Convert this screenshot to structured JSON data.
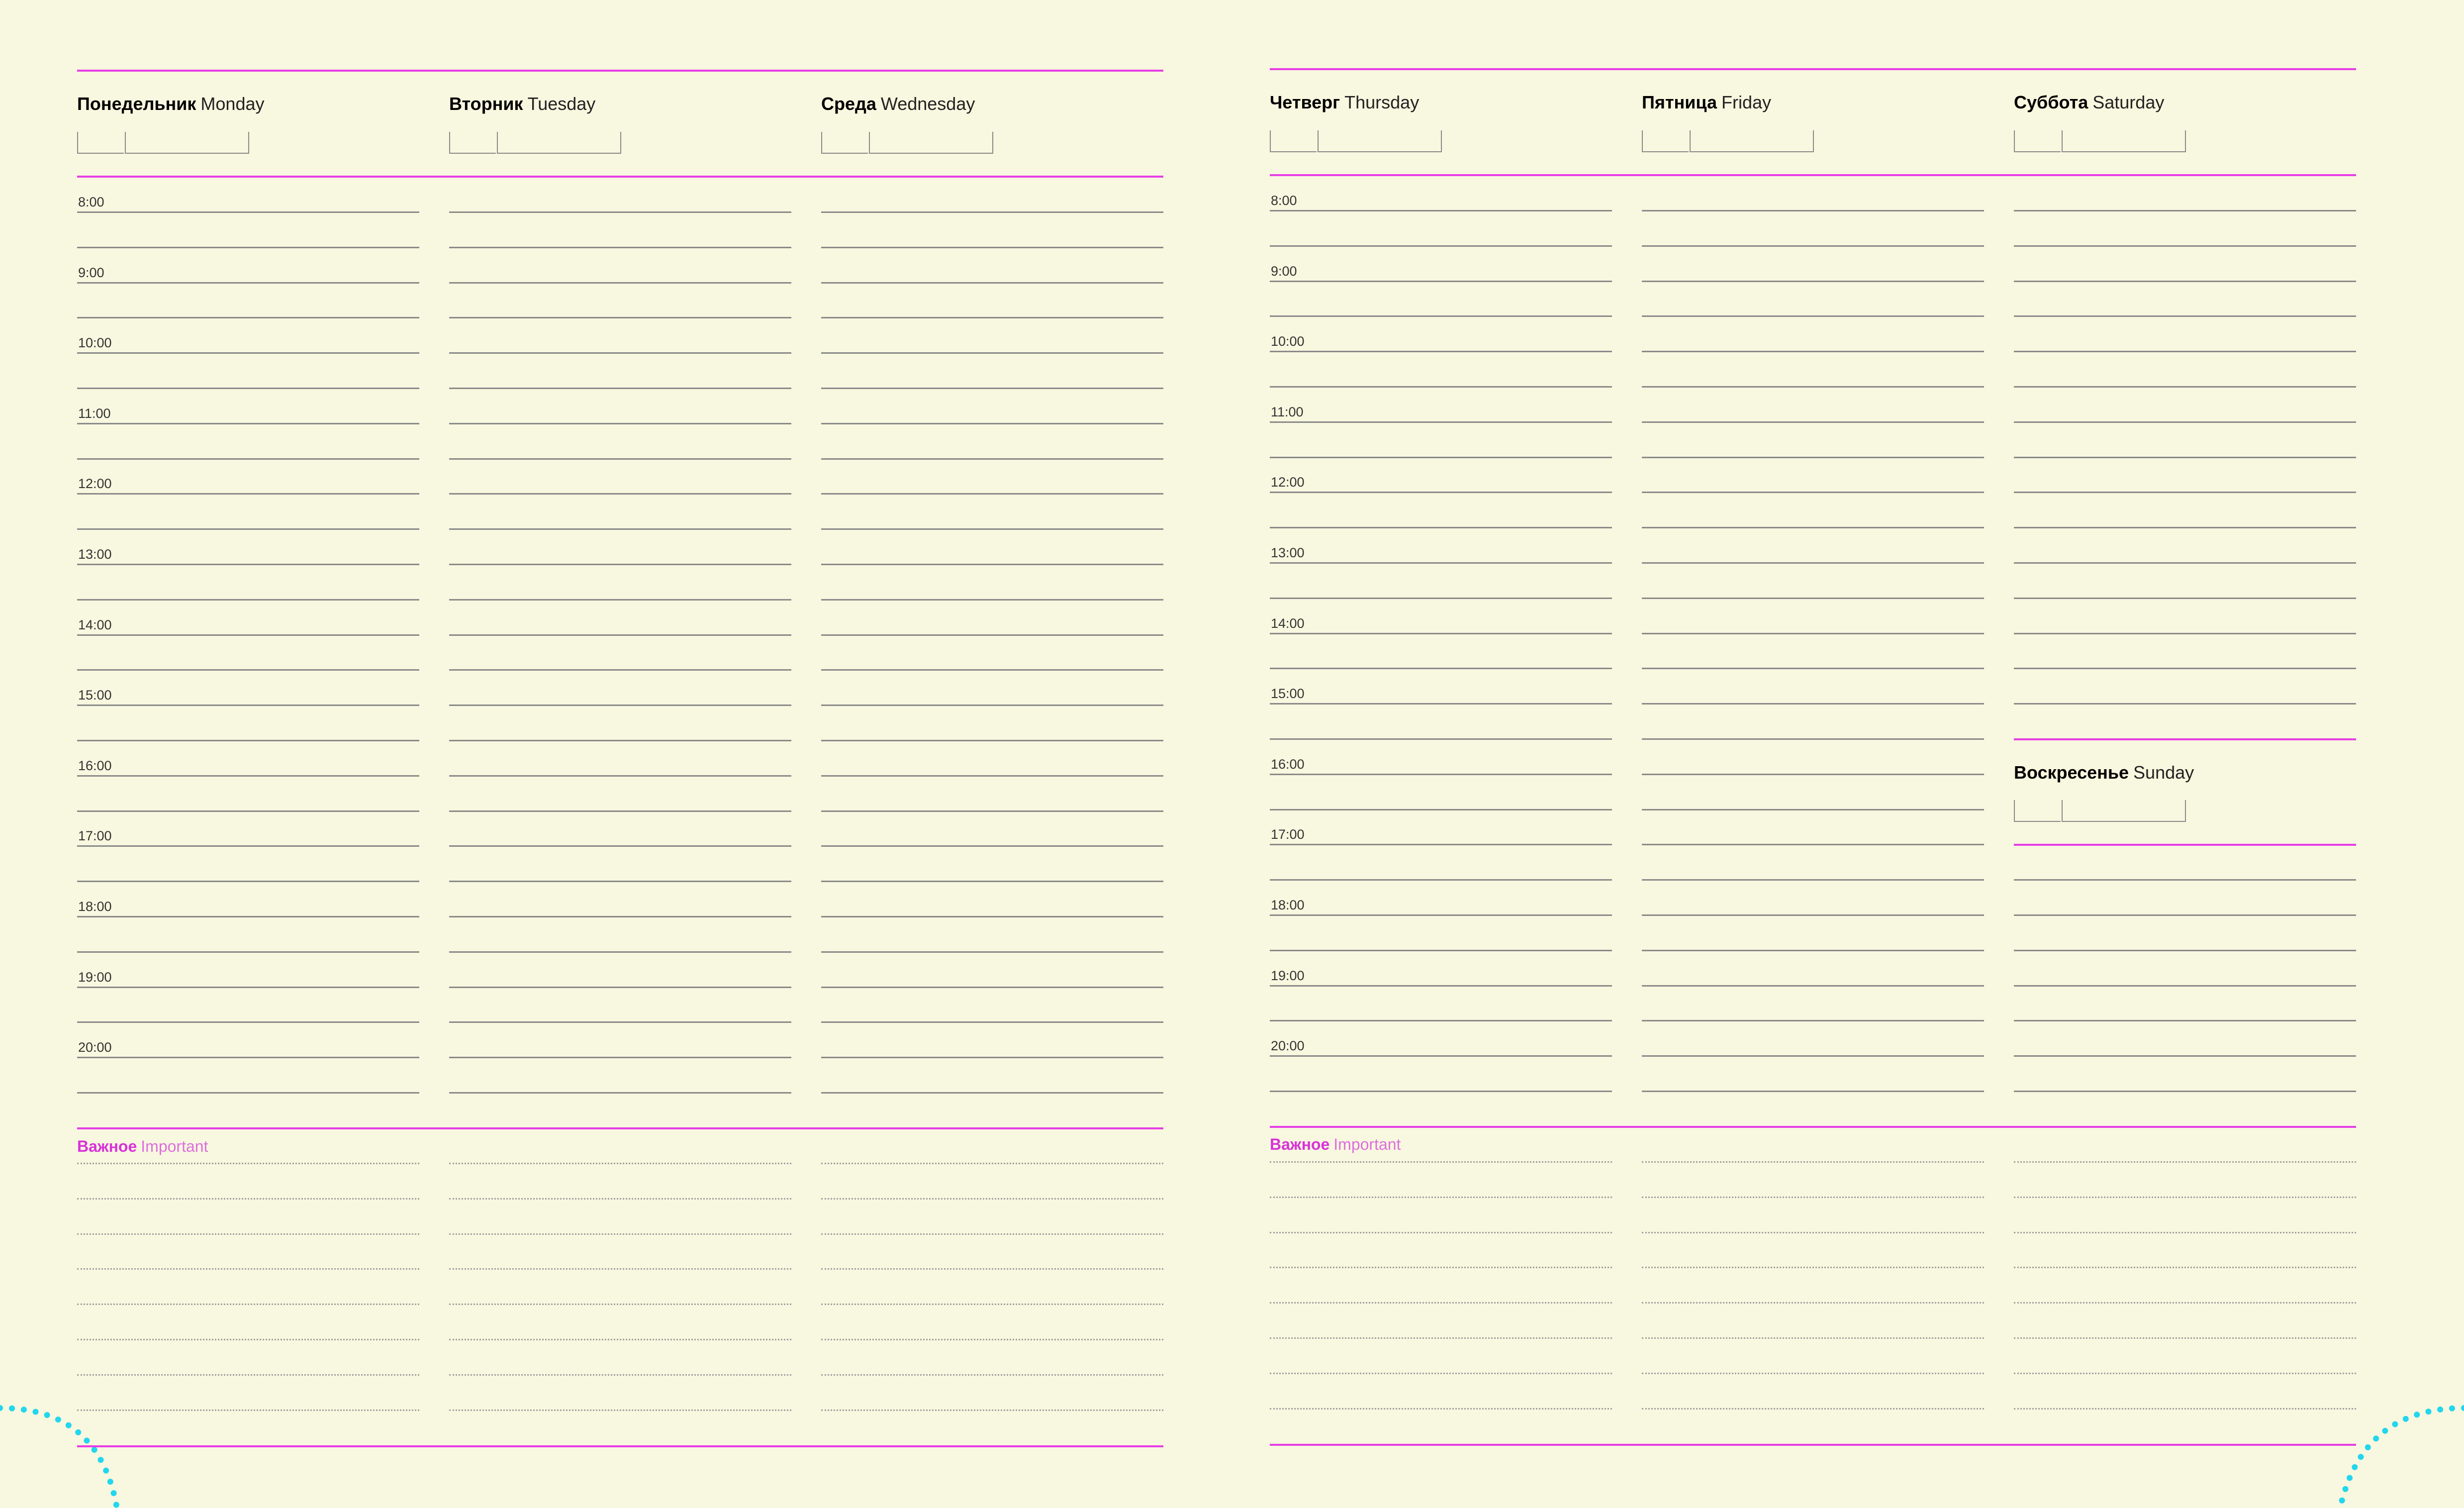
{
  "colors": {
    "background": "#f8f7df",
    "accent_magenta": "#e63ee6",
    "rule_gray": "#8a8a8a",
    "dot_cyan": "#22d6ee"
  },
  "days": [
    {
      "ru": "Понедельник",
      "en": "Monday"
    },
    {
      "ru": "Вторник",
      "en": "Tuesday"
    },
    {
      "ru": "Среда",
      "en": "Wednesday"
    },
    {
      "ru": "Четверг",
      "en": "Thursday"
    },
    {
      "ru": "Пятница",
      "en": "Friday"
    },
    {
      "ru": "Суббота",
      "en": "Saturday"
    },
    {
      "ru": "Воскресенье",
      "en": "Sunday"
    }
  ],
  "times": [
    "8:00",
    "9:00",
    "10:00",
    "11:00",
    "12:00",
    "13:00",
    "14:00",
    "15:00",
    "16:00",
    "17:00",
    "18:00",
    "19:00",
    "20:00"
  ],
  "important": {
    "ru": "Важное",
    "en": "Important"
  }
}
